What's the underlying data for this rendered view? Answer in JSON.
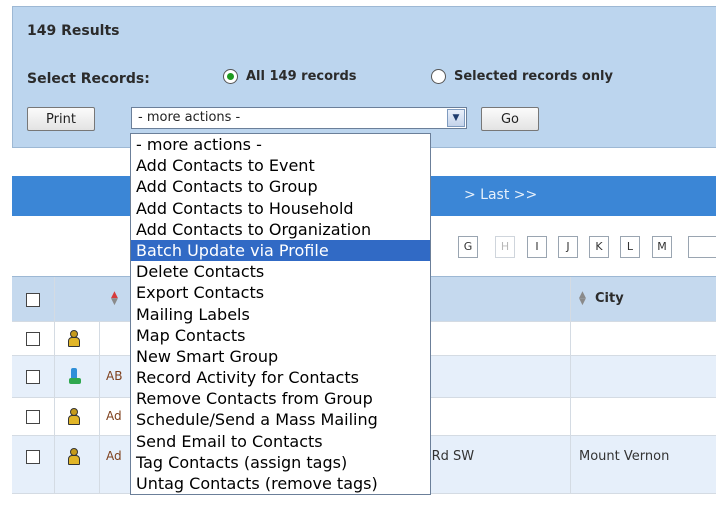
{
  "results": {
    "title": "149 Results"
  },
  "select_records": {
    "label": "Select Records:",
    "all_label": "All 149 records",
    "selected_only_label": "Selected records only",
    "selected": "all"
  },
  "toolbar": {
    "print_label": "Print",
    "go_label": "Go"
  },
  "actions_select": {
    "value": "- more actions -",
    "options": [
      "- more actions -",
      "Add Contacts to Event",
      "Add Contacts to Group",
      "Add Contacts to Household",
      "Add Contacts to Organization",
      "Batch Update via Profile",
      "Delete Contacts",
      "Export Contacts",
      "Mailing Labels",
      "Map Contacts",
      "New Smart Group",
      "Record Activity for Contacts",
      "Remove Contacts from Group",
      "Schedule/Send a Mass Mailing",
      "Send Email to Contacts",
      "Tag Contacts (assign tags)",
      "Untag Contacts (remove tags)"
    ],
    "highlighted": "Batch Update via Profile"
  },
  "pager": {
    "last_label": "> Last >>"
  },
  "alpha_filter": {
    "letters": [
      "G",
      "H",
      "I",
      "J",
      "K",
      "L",
      "M"
    ],
    "disabled": [
      "H"
    ]
  },
  "table": {
    "city_header": "City",
    "rows": [
      {
        "type": "person",
        "name": "",
        "address": "",
        "city": ""
      },
      {
        "type": "organization",
        "name": "AB",
        "address": "",
        "city": ""
      },
      {
        "type": "person",
        "name": "Ad",
        "address": "",
        "city": ""
      },
      {
        "type": "person",
        "name": "Ad",
        "address": "ond Rd SW",
        "city": "Mount Vernon"
      }
    ]
  },
  "colors": {
    "panel_bg": "#bcd5ee",
    "pager_bg": "#3b86d6",
    "header_bg": "#c5d9ee",
    "highlight": "#316ac5",
    "link": "#7d3f1b",
    "sort_up": "#d63b3b",
    "sort_down": "#8a8a8a"
  }
}
